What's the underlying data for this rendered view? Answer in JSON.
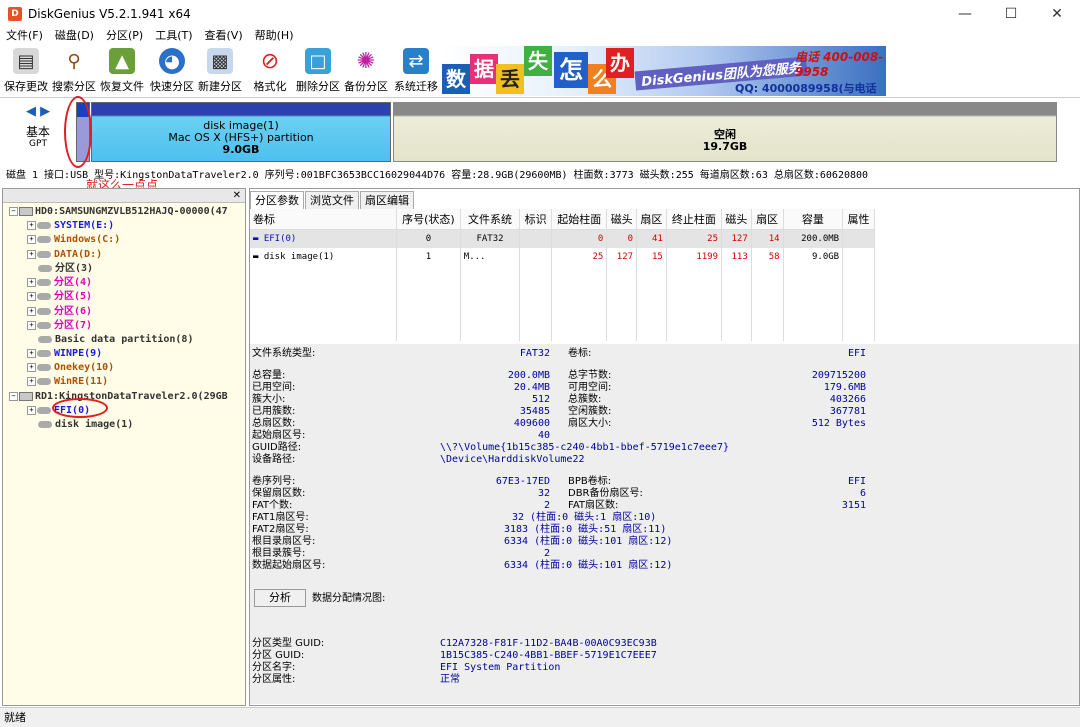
{
  "window": {
    "title": "DiskGenius V5.2.1.941 x64",
    "icon_letter": "D"
  },
  "menu": [
    "文件(F)",
    "磁盘(D)",
    "分区(P)",
    "工具(T)",
    "查看(V)",
    "帮助(H)"
  ],
  "toolbar": [
    "保存更改",
    "搜索分区",
    "恢复文件",
    "快速分区",
    "新建分区",
    "格式化",
    "删除分区",
    "备份分区",
    "系统迁移"
  ],
  "ad": {
    "chars": [
      "数",
      "据",
      "丢",
      "失",
      "怎",
      "么",
      "办"
    ],
    "brand": "DiskGenius团队为您服务",
    "phone": "电话 400-008-9958",
    "qq": "QQ: 4000089958(与电话同号)"
  },
  "diskmap": {
    "disk_type": "基本",
    "disk_sub": "GPT",
    "partition": {
      "name": "disk image(1)",
      "fs": "Mac OS X (HFS+) partition",
      "size": "9.0GB"
    },
    "free": {
      "name": "空闲",
      "size": "19.7GB"
    }
  },
  "annotation": "就这么一点点",
  "diskinfo": "磁盘 1 接口:USB  型号:KingstonDataTraveler2.0  序列号:001BFC3653BCC16029044D76  容量:28.9GB(29600MB)  柱面数:3773  磁头数:255  每道扇区数:63  总扇区数:60620800",
  "tree": [
    {
      "label": "HD0:SAMSUNGMZVLB512HAJQ-00000(47",
      "kind": "disk",
      "color": "c-dk"
    },
    {
      "label": "SYSTEM(E:)",
      "kind": "part",
      "color": "c-blue"
    },
    {
      "label": "Windows(C:)",
      "kind": "part",
      "color": "c-brown"
    },
    {
      "label": "DATA(D:)",
      "kind": "part",
      "color": "c-brown"
    },
    {
      "label": "分区(3)",
      "kind": "part",
      "color": "c-dk"
    },
    {
      "label": "分区(4)",
      "kind": "part",
      "color": "c-pink"
    },
    {
      "label": "分区(5)",
      "kind": "part",
      "color": "c-pink"
    },
    {
      "label": "分区(6)",
      "kind": "part",
      "color": "c-pink"
    },
    {
      "label": "分区(7)",
      "kind": "part",
      "color": "c-pink"
    },
    {
      "label": "Basic data partition(8)",
      "kind": "part",
      "color": "c-dk"
    },
    {
      "label": "WINPE(9)",
      "kind": "part",
      "color": "c-blue"
    },
    {
      "label": "Onekey(10)",
      "kind": "part",
      "color": "c-brown"
    },
    {
      "label": "WinRE(11)",
      "kind": "part",
      "color": "c-brown"
    },
    {
      "label": "RD1:KingstonDataTraveler2.0(29GB",
      "kind": "disk",
      "color": "c-dk"
    },
    {
      "label": "EFI(0)",
      "kind": "part",
      "color": "c-blue"
    },
    {
      "label": "disk image(1)",
      "kind": "part",
      "color": "c-dk"
    }
  ],
  "tabs": [
    "分区参数",
    "浏览文件",
    "扇区编辑"
  ],
  "table": {
    "headers": [
      "卷标",
      "序号(状态)",
      "文件系统",
      "标识",
      "起始柱面",
      "磁头",
      "扇区",
      "终止柱面",
      "磁头",
      "扇区",
      "容量",
      "属性"
    ],
    "rows": [
      [
        "EFI(0)",
        "0",
        "FAT32",
        "",
        "0",
        "0",
        "41",
        "25",
        "127",
        "14",
        "200.0MB",
        ""
      ],
      [
        "disk image(1)",
        "1",
        "M...",
        "",
        "25",
        "127",
        "15",
        "1199",
        "113",
        "58",
        "9.0GB",
        ""
      ]
    ]
  },
  "details": {
    "fs_type_label": "文件系统类型:",
    "fs_type": "FAT32",
    "volume_label": "卷标:",
    "volume": "EFI",
    "left": [
      [
        "总容量:",
        "200.0MB"
      ],
      [
        "已用空间:",
        "20.4MB"
      ],
      [
        "簇大小:",
        "512"
      ],
      [
        "已用簇数:",
        "35485"
      ],
      [
        "总扇区数:",
        "409600"
      ],
      [
        "起始扇区号:",
        "40"
      ]
    ],
    "right": [
      [
        "总字节数:",
        "209715200"
      ],
      [
        "可用空间:",
        "179.6MB"
      ],
      [
        "总簇数:",
        "403266"
      ],
      [
        "空闲簇数:",
        "367781"
      ],
      [
        "扇区大小:",
        "512 Bytes"
      ]
    ],
    "guid_path_label": "GUID路径:",
    "guid_path": "\\\\?\\Volume{1b15c385-c240-4bb1-bbef-5719e1c7eee7}",
    "device_path_label": "设备路径:",
    "device_path": "\\Device\\HarddiskVolume22",
    "vol_serial_label": "卷序列号:",
    "vol_serial": "67E3-17ED",
    "bpb_label": "BPB卷标:",
    "bpb": "EFI",
    "reserved_label": "保留扇区数:",
    "reserved": "32",
    "dbr_label": "DBR备份扇区号:",
    "dbr": "6",
    "fat_count_label": "FAT个数:",
    "fat_count": "2",
    "fat_sectors_label": "FAT扇区数:",
    "fat_sectors": "3151",
    "fat1_label": "FAT1扇区号:",
    "fat1": "32 (柱面:0 磁头:1 扇区:10)",
    "fat2_label": "FAT2扇区号:",
    "fat2": "3183 (柱面:0 磁头:51 扇区:11)",
    "root_sector_label": "根目录扇区号:",
    "root_sector": "6334 (柱面:0 磁头:101 扇区:12)",
    "root_cluster_label": "根目录簇号:",
    "root_cluster": "2",
    "data_start_label": "数据起始扇区号:",
    "data_start": "6334 (柱面:0 磁头:101 扇区:12)",
    "analyze_button": "分析",
    "alloc_label": "数据分配情况图:",
    "ptype_guid_label": "分区类型 GUID:",
    "ptype_guid": "C12A7328-F81F-11D2-BA4B-00A0C93EC93B",
    "part_guid_label": "分区 GUID:",
    "part_guid": "1B15C385-C240-4BB1-BBEF-5719E1C7EEE7",
    "part_name_label": "分区名字:",
    "part_name": "EFI System Partition",
    "part_attr_label": "分区属性:",
    "part_attr": "正常"
  },
  "status": "就绪"
}
